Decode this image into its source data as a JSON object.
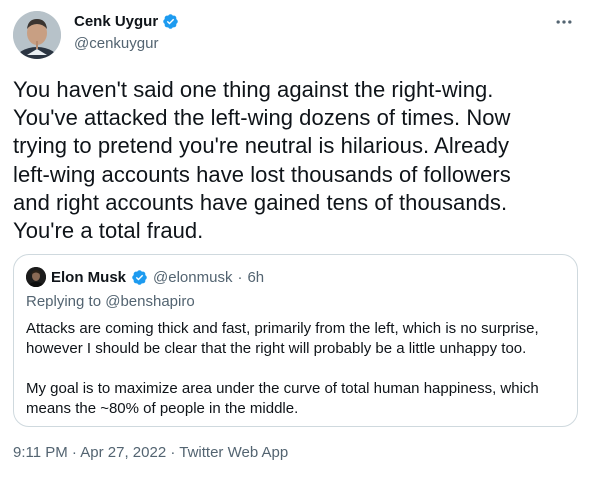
{
  "author": {
    "display_name": "Cenk Uygur",
    "handle": "@cenkuygur",
    "verified": true
  },
  "tweet": {
    "text_lines": [
      "You haven't said one thing against the right-wing.",
      "You've attacked the left-wing dozens of times. Now",
      "trying to pretend you're neutral is hilarious. Already",
      "left-wing accounts have lost thousands of followers",
      "and right accounts have gained tens of thousands.",
      "You're a total fraud."
    ]
  },
  "quote": {
    "display_name": "Elon Musk",
    "verified": true,
    "handle": "@elonmusk",
    "separator": "·",
    "time": "6h",
    "replying_to_label": "Replying to",
    "replying_to_handle": "@benshapiro",
    "paragraphs": [
      {
        "lines": [
          "Attacks are coming thick and fast, primarily from the left, which is no surprise,",
          "however I should be clear that the right will probably be a little unhappy too."
        ]
      },
      {
        "lines": [
          "My goal is to maximize area under the curve of total human happiness, which",
          "means the ~80% of people in the middle."
        ]
      }
    ]
  },
  "meta": {
    "time": "9:11 PM",
    "separator_1": "·",
    "date": "Apr 27, 2022",
    "separator_2": "·",
    "source": "Twitter Web App"
  },
  "icons": {
    "verified": "verified-badge-icon",
    "more": "more-horizontal-icon"
  },
  "colors": {
    "verified_blue": "#1d9bf0",
    "text_primary": "#0f1419",
    "text_secondary": "#536471",
    "border": "#cfd9de"
  }
}
